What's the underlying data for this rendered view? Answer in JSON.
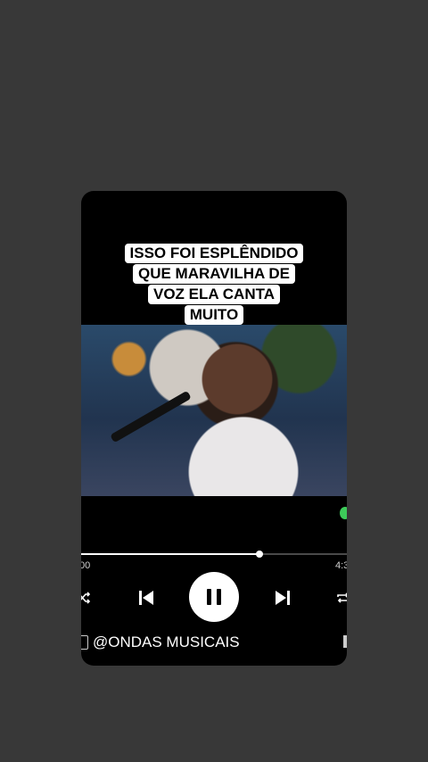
{
  "caption_lines": [
    "ISSO FOI ESPLÊNDIDO",
    "QUE MARAVILHA DE",
    "VOZ ELA CANTA",
    "MUITO"
  ],
  "player": {
    "time_elapsed": "00",
    "time_total": "4:3",
    "progress": 0.67,
    "state": "playing"
  },
  "icons": {
    "shuffle": "shuffle-icon",
    "previous": "previous-icon",
    "pause": "pause-icon",
    "next": "next-icon",
    "repeat": "repeat-icon"
  },
  "footer": {
    "handle": "@ONDAS MUSICAIS"
  },
  "colors": {
    "background": "#383838",
    "card": "#000000",
    "accent": "#3dcc5a"
  }
}
